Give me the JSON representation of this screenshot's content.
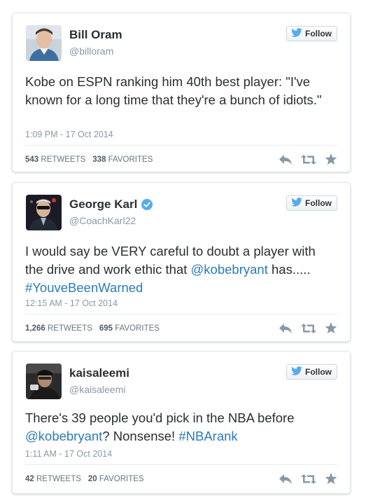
{
  "tweets": [
    {
      "name": "Bill Oram",
      "handle": "@billoram",
      "verified": false,
      "follow_label": "Follow",
      "text_parts": [
        "Kobe on ESPN ranking him 40th best player: \"I've known for a long time that they're a bunch of idiots.\""
      ],
      "timestamp": "1:09 PM - 17 Oct 2014",
      "retweets": "543",
      "retweets_label": "RETWEETS",
      "favorites": "338",
      "favorites_label": "FAVORITES"
    },
    {
      "name": "George Karl",
      "handle": "@CoachKarl22",
      "verified": true,
      "follow_label": "Follow",
      "text_before": "I would say be VERY careful to doubt a player with the drive and work ethic that ",
      "mention": "@kobebryant",
      "text_after": " has.....",
      "hashtag": "#YouveBeenWarned",
      "timestamp": "12:15 AM - 17 Oct 2014",
      "retweets": "1,266",
      "retweets_label": "RETWEETS",
      "favorites": "695",
      "favorites_label": "FAVORITES"
    },
    {
      "name": "kaisaleemi",
      "handle": "@kaisaleemi",
      "verified": false,
      "follow_label": "Follow",
      "text_before": "There's 39 people you'd pick in the NBA before ",
      "mention": "@kobebryant",
      "text_middle": "? Nonsense! ",
      "hashtag": "#NBArank",
      "timestamp": "1:11 AM - 17 Oct 2014",
      "retweets": "42",
      "retweets_label": "RETWEETS",
      "favorites": "20",
      "favorites_label": "FAVORITES"
    }
  ],
  "icons": {
    "reply": "reply-icon",
    "retweet": "retweet-icon",
    "favorite": "star-icon",
    "bird": "twitter-bird-icon",
    "verified": "verified-badge-icon"
  },
  "colors": {
    "link": "#2b7bb9",
    "twitter_blue": "#55acee",
    "muted": "#8899a6",
    "icon_gray": "#8899a6"
  }
}
